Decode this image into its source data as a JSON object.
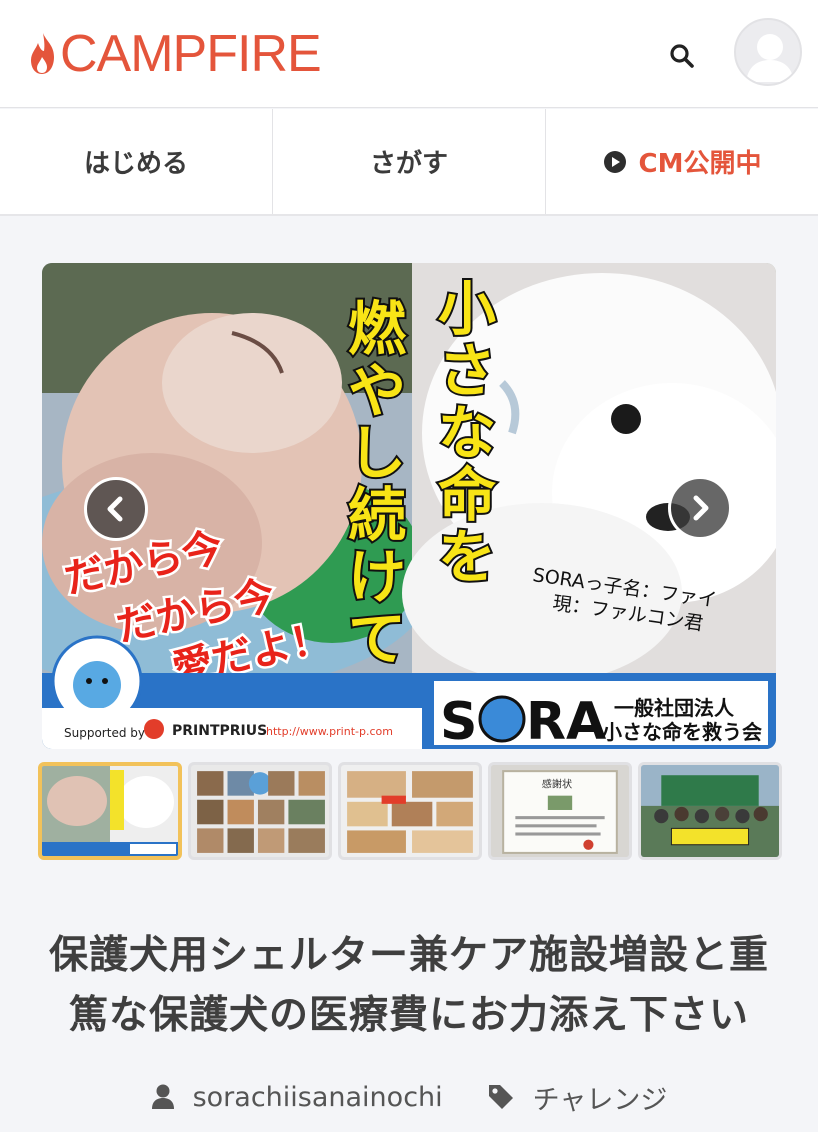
{
  "header": {
    "logo_text": "CAMPFIRE",
    "brand_color": "#e4553b",
    "search_icon": "search-icon",
    "avatar_icon": "user-avatar-icon"
  },
  "nav": {
    "tabs": [
      {
        "label": "はじめる"
      },
      {
        "label": "さがす"
      },
      {
        "label": "CM公開中",
        "icon": "play-circle-icon"
      }
    ]
  },
  "carousel": {
    "main_image": {
      "vertical_text": "小さな命を燃やし続けて",
      "red_text": [
        "だから今",
        "だから今",
        "愛だよ！"
      ],
      "caption": [
        "SORAっ子名：ファイ",
        "現：ファルコン君"
      ],
      "banner_sora": "SORA",
      "banner_org_line1": "一般社団法人",
      "banner_org_line2": "小さな命を救う会",
      "supported_by": "Supported by",
      "sponsor": "PRINTPRIUS",
      "sponsor_url": "http://www.print-p.com"
    },
    "prev_icon": "chevron-left-icon",
    "next_icon": "chevron-right-icon",
    "thumbnails_count": 5,
    "active_index": 0,
    "thumb3_text": "感謝状"
  },
  "project": {
    "title": "保護犬用シェルター兼ケア施設増設と重篤な保護犬の医療費にお力添え下さい",
    "author": "sorachiisanainochi",
    "category": "チャレンジ"
  }
}
